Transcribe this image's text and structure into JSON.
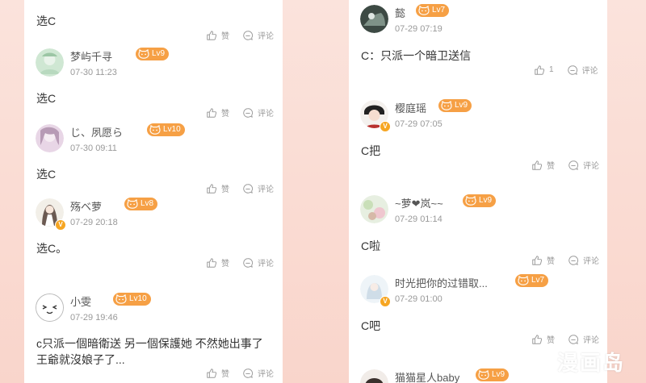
{
  "icons": {
    "like": "thumbs-up-icon",
    "comment": "comment-icon",
    "level": "cat-icon",
    "verified": "v-badge-icon"
  },
  "colors": {
    "badge": "#f6a045",
    "accent": "#f6a623",
    "background": "#f9d5cb"
  },
  "left_column": {
    "top_comment": {
      "text": "选C",
      "like_label": "赞",
      "comment_label": "评论"
    },
    "comments": [
      {
        "username": "梦屿千寻",
        "level": "Lv9",
        "time": "07-30 11:23",
        "text": "选C",
        "like_label": "赞",
        "comment_label": "评论"
      },
      {
        "username": "じ、夙愿ら",
        "level": "Lv10",
        "time": "07-30 09:11",
        "text": "选C",
        "like_label": "赞",
        "comment_label": "评论"
      },
      {
        "username": "殇ベ萝",
        "level": "Lv8",
        "time": "07-29 20:18",
        "text": "选C。",
        "like_label": "赞",
        "comment_label": "评论",
        "verified": "V"
      },
      {
        "username": "小雯",
        "level": "Lv10",
        "time": "07-29 19:46",
        "text": "c只派一個暗衛送 另一個保護她 不然她出事了 王爺就沒娘子了...",
        "like_label": "赞",
        "comment_label": "评论"
      }
    ]
  },
  "right_column": {
    "comments": [
      {
        "username": "懿",
        "level": "Lv7",
        "time": "07-29 07:19",
        "text": "C：只派一个暗卫送信",
        "like_count": "1",
        "comment_label": "评论"
      },
      {
        "username": "樱庭瑶",
        "level": "Lv9",
        "time": "07-29 07:05",
        "text": "C把",
        "like_label": "赞",
        "comment_label": "评论",
        "verified": "V"
      },
      {
        "username": "~萝❤岚~~",
        "level": "Lv9",
        "time": "07-29 01:14",
        "text": "C啦",
        "like_label": "赞",
        "comment_label": "评论"
      },
      {
        "username": "时光把你的过错取...",
        "level": "Lv7",
        "time": "07-29 01:00",
        "text": "C吧",
        "like_label": "赞",
        "comment_label": "评论",
        "verified": "V"
      },
      {
        "username": "猫猫星人baby",
        "level": "Lv9"
      }
    ]
  },
  "watermark": {
    "letter": "M",
    "text": "漫画岛"
  }
}
